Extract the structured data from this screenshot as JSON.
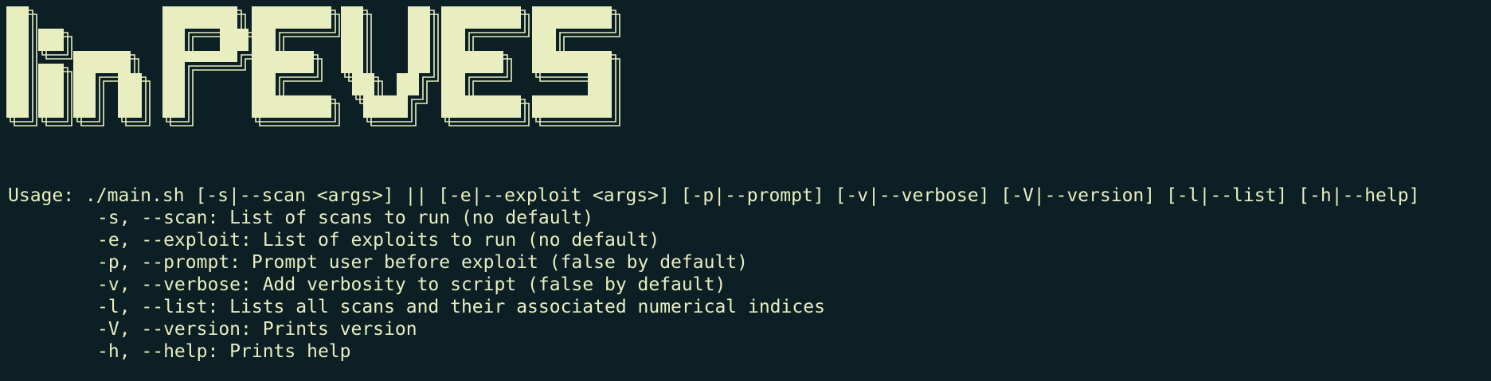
{
  "theme": {
    "background": "#0b1f24",
    "foreground": "#e8eec0"
  },
  "banner": {
    "text": "linPEVES"
  },
  "usage": {
    "line": "Usage: ./main.sh [-s|--scan <args>] || [-e|--exploit <args>] [-p|--prompt] [-v|--verbose] [-V|--version] [-l|--list] [-h|--help]"
  },
  "options": [
    "-s, --scan: List of scans to run (no default)",
    "-e, --exploit: List of exploits to run (no default)",
    "-p, --prompt: Prompt user before exploit (false by default)",
    "-v, --verbose: Add verbosity to script (false by default)",
    "-l, --list: Lists all scans and their associated numerical indices",
    "-V, --version: Prints version",
    "-h, --help: Prints help"
  ]
}
